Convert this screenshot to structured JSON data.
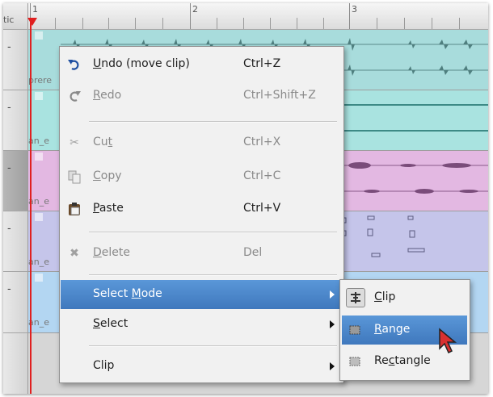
{
  "ruler": {
    "corner_label": "tic",
    "bar_numbers": [
      "1",
      "2",
      "3"
    ]
  },
  "tracks": [
    {
      "clip_name": "prere",
      "color": "#a8dcdc"
    },
    {
      "clip_name": "an_e",
      "color": "#a9e3e0"
    },
    {
      "clip_name": "an_e",
      "color": "#e3b8e2"
    },
    {
      "clip_name": "an_e",
      "color": "#c5c5ea"
    },
    {
      "clip_name": "an_e",
      "color": "#b3d6f2"
    }
  ],
  "context_menu": {
    "items": [
      {
        "icon": "undo-icon",
        "pre": "",
        "accel": "U",
        "post": "ndo (move clip)",
        "shortcut": "Ctrl+Z",
        "enabled": true
      },
      {
        "icon": "redo-icon",
        "pre": "",
        "accel": "R",
        "post": "edo",
        "shortcut": "Ctrl+Shift+Z",
        "enabled": false
      },
      {
        "icon": "cut-icon",
        "pre": "Cu",
        "accel": "t",
        "post": "",
        "shortcut": "Ctrl+X",
        "enabled": false
      },
      {
        "icon": "copy-icon",
        "pre": "",
        "accel": "C",
        "post": "opy",
        "shortcut": "Ctrl+C",
        "enabled": false
      },
      {
        "icon": "paste-icon",
        "pre": "",
        "accel": "P",
        "post": "aste",
        "shortcut": "Ctrl+V",
        "enabled": true
      },
      {
        "icon": "delete-icon",
        "pre": "",
        "accel": "D",
        "post": "elete",
        "shortcut": "Del",
        "enabled": false
      },
      {
        "icon": "",
        "pre": "Select ",
        "accel": "M",
        "post": "ode",
        "shortcut": "",
        "enabled": true,
        "submenu": true,
        "highlighted": true
      },
      {
        "icon": "",
        "pre": "",
        "accel": "S",
        "post": "elect",
        "shortcut": "",
        "enabled": true,
        "submenu": true
      },
      {
        "icon": "",
        "pre": "Clip",
        "accel": "",
        "post": "",
        "shortcut": "",
        "enabled": true,
        "submenu": true
      }
    ]
  },
  "select_mode_submenu": {
    "items": [
      {
        "icon": "clip-mode-icon",
        "pre": "",
        "accel": "C",
        "post": "lip",
        "checked": true
      },
      {
        "icon": "range-mode-icon",
        "pre": "",
        "accel": "R",
        "post": "ange",
        "highlighted": true
      },
      {
        "icon": "rectangle-mode-icon",
        "pre": "Re",
        "accel": "c",
        "post": "tangle"
      }
    ]
  },
  "colors": {
    "menu_highlight": "#4a87cc",
    "playhead": "#e02020"
  }
}
